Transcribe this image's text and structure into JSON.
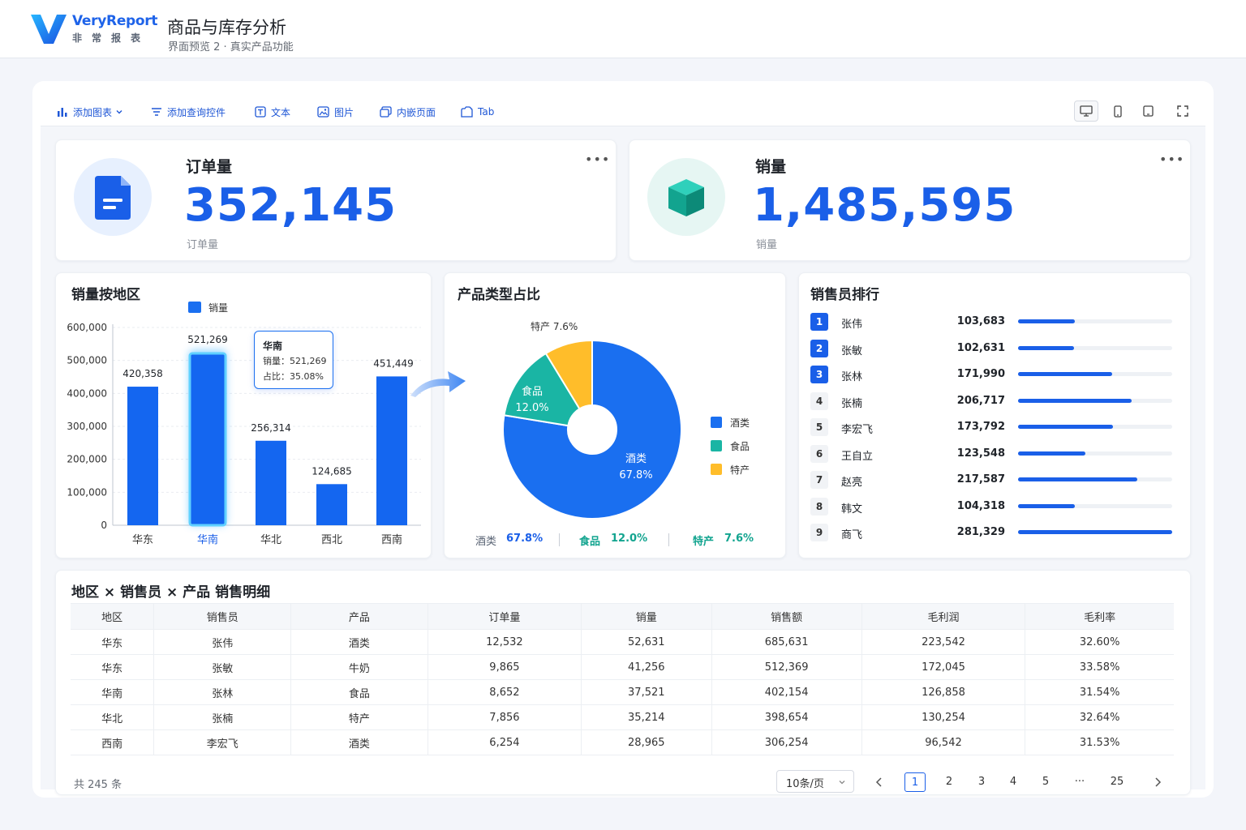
{
  "app": {
    "brand": "VeryReport",
    "brand_cn": "非常报表",
    "title": "商品与库存分析",
    "subtitle": "界面预览 2 · 真实产品功能"
  },
  "toolbar": {
    "items": [
      {
        "label": "添加图表",
        "icon": "bar-chart-icon"
      },
      {
        "label": "添加查询控件",
        "icon": "filter-icon"
      },
      {
        "label": "文本",
        "icon": "text-icon"
      },
      {
        "label": "图片",
        "icon": "image-icon"
      },
      {
        "label": "内嵌页面",
        "icon": "embed-icon"
      },
      {
        "label": "Tab",
        "icon": "tab-icon"
      }
    ],
    "devices": [
      "desktop-icon",
      "phone-icon",
      "tablet-icon",
      "fullscreen-icon"
    ]
  },
  "kpis": [
    {
      "label": "订单量",
      "value": "352,145",
      "sub": "订单量",
      "icon": "document-icon"
    },
    {
      "label": "销量",
      "value": "1,485,595",
      "sub": "销量",
      "icon": "cube-icon"
    }
  ],
  "bar_chart": {
    "title": "销量按地区",
    "tooltip": {
      "region": "华南",
      "line1": "销量：521,269",
      "line2": "占比：35.08%"
    }
  },
  "pie_chart": {
    "title": "产品类型占比",
    "summary": [
      {
        "name": "酒类",
        "pct": "67.8%"
      },
      {
        "name": "食品",
        "pct": "12.0%"
      },
      {
        "name": "特产",
        "pct": "7.6%"
      }
    ]
  },
  "chart_data": [
    {
      "type": "bar",
      "title": "销量按地区",
      "categories": [
        "华东",
        "华南",
        "华北",
        "西北",
        "西南"
      ],
      "series": [
        {
          "name": "销量",
          "values": [
            420358,
            521269,
            256314,
            124685,
            451449
          ]
        }
      ],
      "value_labels": [
        "420,358",
        "521,269",
        "256,314",
        "124,685",
        "451,449"
      ],
      "yticks": [
        "0",
        "100,000",
        "200,000",
        "300,000",
        "400,000",
        "500,000",
        "600,000"
      ],
      "ylim": [
        0,
        600000
      ],
      "highlight": "华南",
      "legend": "top",
      "grid": true
    },
    {
      "type": "pie",
      "title": "产品类型占比",
      "labels": [
        "酒类",
        "食品",
        "特产"
      ],
      "values": [
        67.8,
        12.0,
        7.6
      ],
      "label_texts": [
        "67.8%",
        "12.0%",
        "7.6%"
      ],
      "colors": [
        "#1a6ff0",
        "#1ab5a4",
        "#ffbd2a"
      ],
      "legend": "right"
    }
  ],
  "ranking": {
    "title": "销售员排行",
    "max": 281329,
    "rows": [
      {
        "rank": "1",
        "name": "张伟",
        "value": "103,683",
        "num": 103683
      },
      {
        "rank": "2",
        "name": "张敏",
        "value": "102,631",
        "num": 102631
      },
      {
        "rank": "3",
        "name": "张林",
        "value": "171,990",
        "num": 171990
      },
      {
        "rank": "4",
        "name": "张楠",
        "value": "206,717",
        "num": 206717
      },
      {
        "rank": "5",
        "name": "李宏飞",
        "value": "173,792",
        "num": 173792
      },
      {
        "rank": "6",
        "name": "王自立",
        "value": "123,548",
        "num": 123548
      },
      {
        "rank": "7",
        "name": "赵亮",
        "value": "217,587",
        "num": 217587
      },
      {
        "rank": "8",
        "name": "韩文",
        "value": "104,318",
        "num": 104318
      },
      {
        "rank": "9",
        "name": "商飞",
        "value": "281,329",
        "num": 281329
      }
    ]
  },
  "detail": {
    "title": "地区 × 销售员 × 产品 销售明细",
    "columns": [
      "地区",
      "销售员",
      "产品",
      "订单量",
      "销量",
      "销售额",
      "毛利润",
      "毛利率"
    ],
    "rows": [
      [
        "华东",
        "张伟",
        "酒类",
        "12,532",
        "52,631",
        "685,631",
        "223,542",
        "32.60%"
      ],
      [
        "华东",
        "张敏",
        "牛奶",
        "9,865",
        "41,256",
        "512,369",
        "172,045",
        "33.58%"
      ],
      [
        "华南",
        "张林",
        "食品",
        "8,652",
        "37,521",
        "402,154",
        "126,858",
        "31.54%"
      ],
      [
        "华北",
        "张楠",
        "特产",
        "7,856",
        "35,214",
        "398,654",
        "130,254",
        "32.64%"
      ],
      [
        "西南",
        "李宏飞",
        "酒类",
        "6,254",
        "28,965",
        "306,254",
        "96,542",
        "31.53%"
      ]
    ],
    "total": "共 245 条",
    "page_size": "10条/页",
    "pages": [
      "1",
      "2",
      "3",
      "4",
      "5",
      "···",
      "25"
    ]
  }
}
